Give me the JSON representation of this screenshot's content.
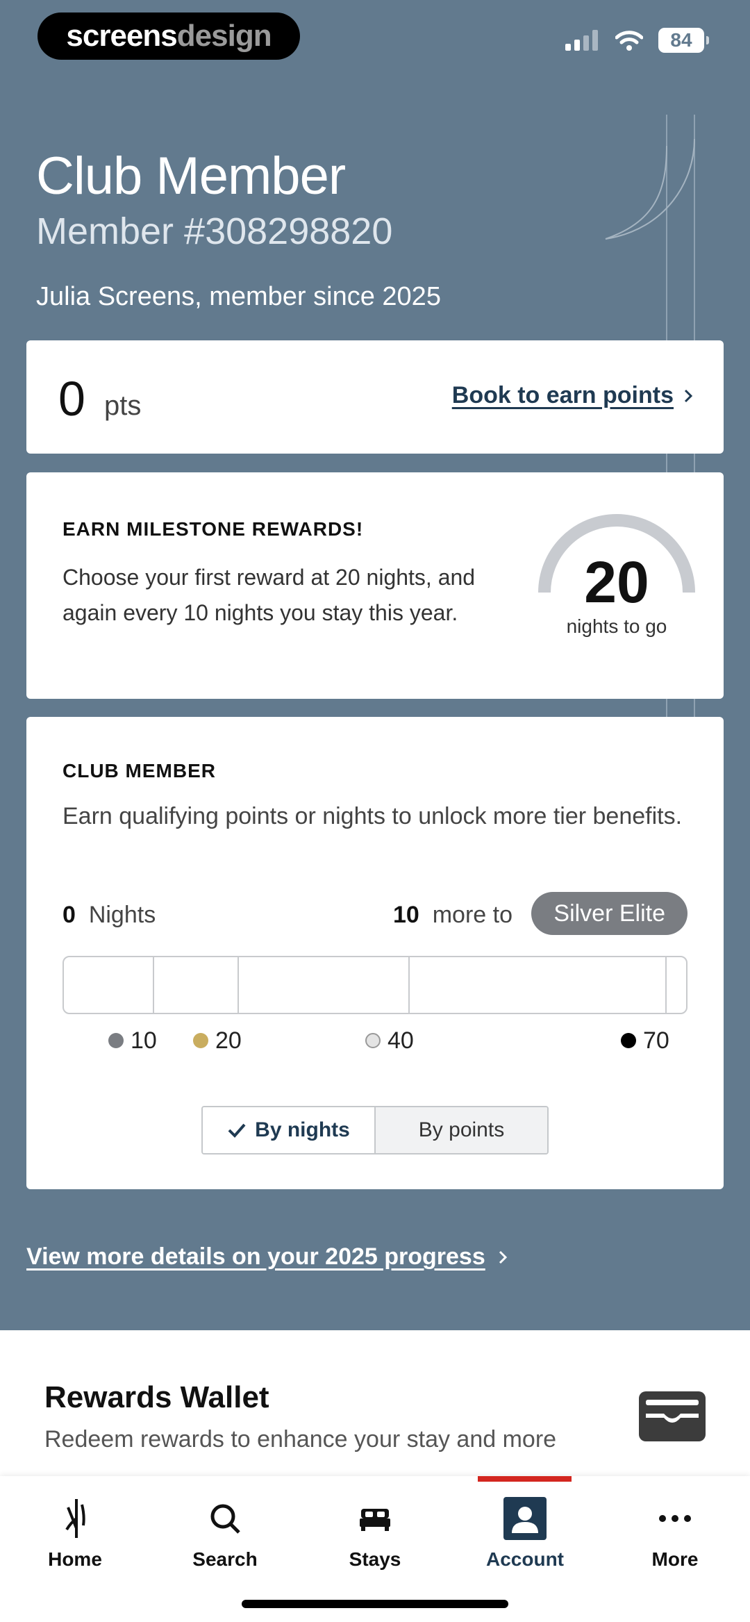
{
  "status_bar": {
    "brand_part1": "screens",
    "brand_part2": "design",
    "battery": "84"
  },
  "header": {
    "tier_title": "Club Member",
    "member_number": "Member #308298820",
    "member_since": "Julia Screens, member since 2025"
  },
  "points_card": {
    "points_value": "0",
    "points_unit": "pts",
    "book_link": "Book to earn points"
  },
  "milestone_card": {
    "heading": "EARN MILESTONE REWARDS!",
    "body": "Choose your first reward at 20 nights, and again every 10 nights you stay this year.",
    "nights_to_go_value": "20",
    "nights_to_go_label": "nights to go"
  },
  "tier_card": {
    "heading": "CLUB MEMBER",
    "body": "Earn qualifying points or nights to unlock more tier benefits.",
    "nights_count": "0",
    "nights_label": "Nights",
    "more_count": "10",
    "more_label": "more to",
    "next_tier": "Silver Elite",
    "progress_fraction": 0,
    "milestones": [
      {
        "value": "10",
        "color": "#7a7d82"
      },
      {
        "value": "20",
        "color": "#c9ad5f"
      },
      {
        "value": "40",
        "color": "#e4e4e4"
      },
      {
        "value": "70",
        "color": "#000000"
      }
    ],
    "toggle": {
      "by_nights": "By nights",
      "by_points": "By points",
      "selected": "by_nights"
    }
  },
  "progress_link": "View more details on your 2025 progress",
  "wallet": {
    "title": "Rewards Wallet",
    "subtitle": "Redeem rewards to enhance your stay and more"
  },
  "tabbar": {
    "items": [
      {
        "label": "Home",
        "icon": "home-logo-icon"
      },
      {
        "label": "Search",
        "icon": "search-icon"
      },
      {
        "label": "Stays",
        "icon": "bed-icon"
      },
      {
        "label": "Account",
        "icon": "account-icon"
      },
      {
        "label": "More",
        "icon": "more-dots-icon"
      }
    ],
    "active": "Account"
  },
  "colors": {
    "hero_bg": "#627a8e",
    "link_navy": "#1f3a52",
    "active_indicator": "#d3261f",
    "tier_pill": "#7a7d82"
  }
}
